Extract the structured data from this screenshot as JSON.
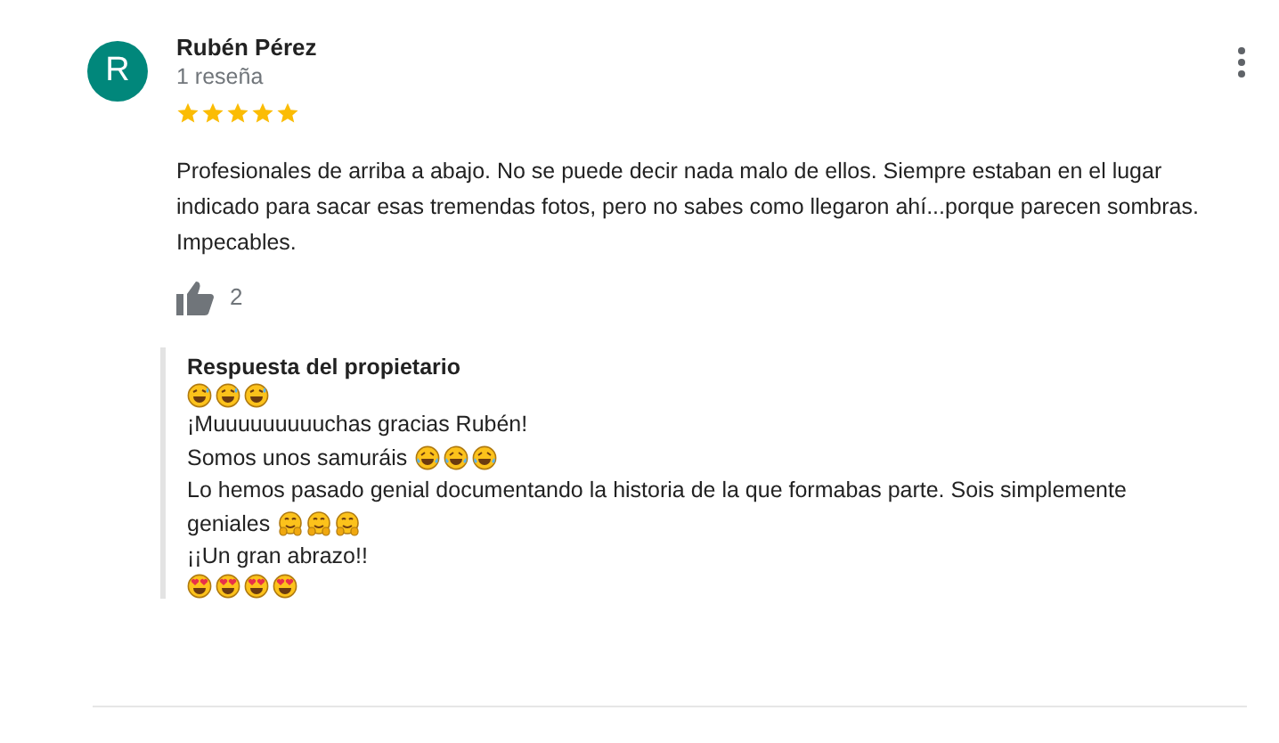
{
  "review": {
    "avatar_letter": "R",
    "author": "Rubén Pérez",
    "meta": "1 reseña",
    "stars": 5,
    "text_lines": [
      "Profesionales de arriba a abajo. No se puede decir nada malo de ellos. Siempre estaban en el lugar",
      "indicado para sacar esas tremendas fotos, pero no sabes como llegaron ahí...porque parecen sombras.",
      "Impecables."
    ],
    "likes": "2"
  },
  "reply": {
    "title": "Respuesta del propietario",
    "lines": [
      {
        "emojis": [
          {
            "kind": "sweat-smile"
          },
          {
            "kind": "sweat-smile"
          },
          {
            "kind": "sweat-smile"
          }
        ]
      },
      {
        "text": "¡Muuuuuuuuuchas gracias Rubén!"
      },
      {
        "text": "Somos unos samuráis",
        "emojis": [
          {
            "kind": "tears-of-joy"
          },
          {
            "kind": "tears-of-joy"
          },
          {
            "kind": "tears-of-joy"
          }
        ]
      },
      {
        "text": "Lo hemos pasado genial documentando la historia de la que formabas parte. Sois simplemente"
      },
      {
        "text": "geniales",
        "emojis": [
          {
            "kind": "hugging"
          },
          {
            "kind": "hugging"
          },
          {
            "kind": "hugging"
          }
        ]
      },
      {
        "text": "¡¡Un gran abrazo!!"
      },
      {
        "emojis": [
          {
            "kind": "heart-eyes"
          },
          {
            "kind": "heart-eyes"
          },
          {
            "kind": "heart-eyes"
          },
          {
            "kind": "heart-eyes"
          }
        ]
      }
    ]
  }
}
